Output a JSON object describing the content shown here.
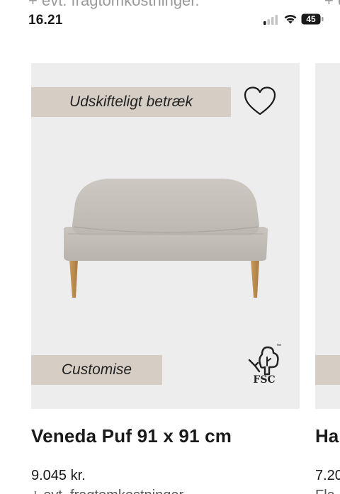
{
  "status_bar": {
    "time": "16.21",
    "battery": "45"
  },
  "top_cut_text": "+ evt. fragtomkostninger.",
  "top_cut_text_right": "+ e",
  "product": {
    "badge_top": "Udskifteligt betræk",
    "badge_bottom": "Customise",
    "certification": "FSC",
    "certification_tm": "™",
    "name": "Veneda Puf 91 x 91 cm",
    "price": "9.045 kr.",
    "sub_text": "+ evt. fragtomkostninger."
  },
  "next_product": {
    "name": "Ha",
    "price": "7.20",
    "sub_text": "Fla"
  },
  "icons": {
    "signal": "signal-icon",
    "wifi": "wifi-icon",
    "battery": "battery-icon",
    "favorite": "heart-icon",
    "fsc": "fsc-tree-icon"
  },
  "colors": {
    "card_bg": "#ededed",
    "badge_bg": "#d6cec4",
    "text": "#1a1a1a"
  }
}
